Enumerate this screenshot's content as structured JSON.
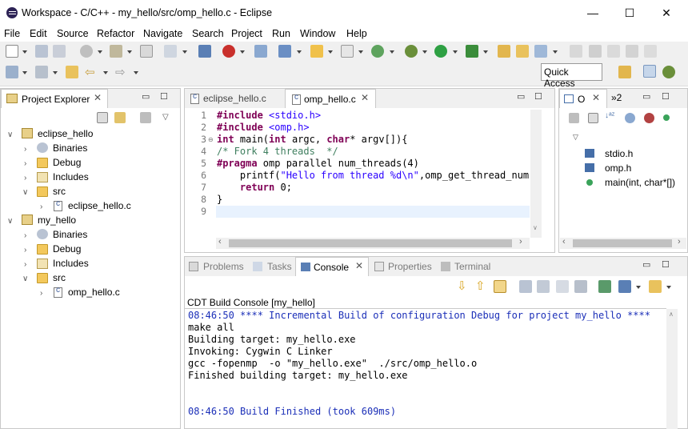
{
  "window": {
    "title": "Workspace - C/C++ - my_hello/src/omp_hello.c - Eclipse",
    "minimize": "—",
    "maximize": "☐",
    "close": "✕"
  },
  "menu": [
    "File",
    "Edit",
    "Source",
    "Refactor",
    "Navigate",
    "Search",
    "Project",
    "Run",
    "Window",
    "Help"
  ],
  "toolbar": {
    "quick_access": "Quick Access"
  },
  "project_explorer": {
    "tab_label": "Project Explorer",
    "tree": [
      {
        "label": "eclipse_hello",
        "kind": "project",
        "expanded": true
      },
      {
        "label": "Binaries",
        "kind": "binaries"
      },
      {
        "label": "Debug",
        "kind": "folder"
      },
      {
        "label": "Includes",
        "kind": "includes"
      },
      {
        "label": "src",
        "kind": "folder",
        "expanded": true
      },
      {
        "label": "eclipse_hello.c",
        "kind": "cfile"
      },
      {
        "label": "my_hello",
        "kind": "project",
        "expanded": true
      },
      {
        "label": "Binaries",
        "kind": "binaries"
      },
      {
        "label": "Debug",
        "kind": "folder"
      },
      {
        "label": "Includes",
        "kind": "includes"
      },
      {
        "label": "src",
        "kind": "folder",
        "expanded": true
      },
      {
        "label": "omp_hello.c",
        "kind": "cfile"
      }
    ]
  },
  "editor": {
    "tabs": [
      {
        "label": "eclipse_hello.c",
        "active": false
      },
      {
        "label": "omp_hello.c",
        "active": true
      }
    ],
    "line_numbers": [
      "1",
      "2",
      "3",
      "4",
      "5",
      "6",
      "7",
      "8",
      "9"
    ],
    "lines": [
      "#include <stdio.h>",
      "#include <omp.h>",
      "int main(int argc, char* argv[]){",
      "/* Fork 4 threads  */",
      "#pragma omp parallel num_threads(4)",
      "    printf(\"Hello from thread %d\\n\",omp_get_thread_num()",
      "    return 0;",
      "}",
      ""
    ]
  },
  "outline": {
    "tab_label": "O",
    "second_tab": "»2",
    "items": [
      {
        "label": "stdio.h",
        "kind": "include"
      },
      {
        "label": "omp.h",
        "kind": "include"
      },
      {
        "label": "main(int, char*[])",
        "kind": "function"
      }
    ]
  },
  "bottom_tabs": [
    {
      "label": "Problems",
      "active": false
    },
    {
      "label": "Tasks",
      "active": false
    },
    {
      "label": "Console",
      "active": true
    },
    {
      "label": "Properties",
      "active": false
    },
    {
      "label": "Terminal",
      "active": false
    }
  ],
  "console": {
    "header": "CDT Build Console [my_hello]",
    "lines": [
      {
        "text": "08:46:50 **** Incremental Build of configuration Debug for project my_hello ****",
        "style": "blue"
      },
      {
        "text": "make all",
        "style": "plain"
      },
      {
        "text": "Building target: my_hello.exe",
        "style": "plain"
      },
      {
        "text": "Invoking: Cygwin C Linker",
        "style": "plain"
      },
      {
        "text": "gcc -fopenmp  -o \"my_hello.exe\"  ./src/omp_hello.o",
        "style": "plain"
      },
      {
        "text": "Finished building target: my_hello.exe",
        "style": "plain"
      },
      {
        "text": "",
        "style": "plain"
      },
      {
        "text": "",
        "style": "plain"
      },
      {
        "text": "08:46:50 Build Finished (took 609ms)",
        "style": "blue"
      }
    ]
  },
  "colors": {
    "keyword": "#7f0055",
    "string": "#2a00ff",
    "comment": "#3f7f5f",
    "console_blue": "#1b2fb8",
    "current_line": "#e8f2fe"
  }
}
